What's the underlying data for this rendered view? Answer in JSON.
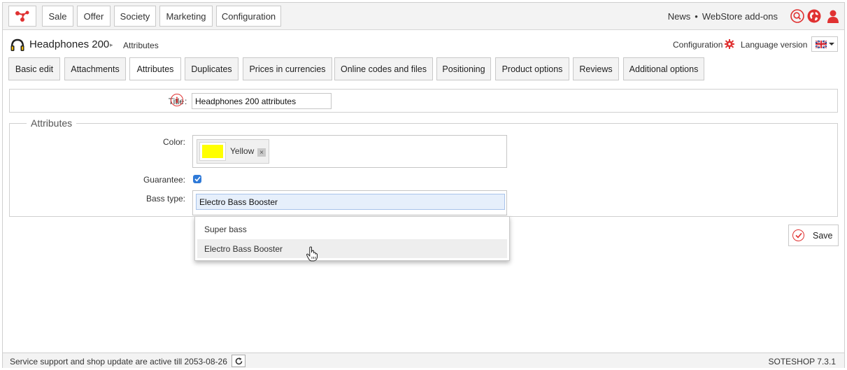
{
  "colors": {
    "accent": "#e03131",
    "checkbox": "#2f7ad8",
    "swatch_yellow": "#ffff00",
    "input_focus_bg": "#e6effb"
  },
  "topnav": {
    "logo_icon": "network-logo-icon",
    "items": [
      {
        "label": "Sale"
      },
      {
        "label": "Offer"
      },
      {
        "label": "Society"
      },
      {
        "label": "Marketing"
      },
      {
        "label": "Configuration"
      }
    ],
    "news": "News",
    "separator": "•",
    "addons": "WebStore add-ons",
    "icons": [
      "search-icon",
      "globe-icon",
      "user-icon"
    ]
  },
  "header": {
    "product_icon": "headphones-icon",
    "product_name": "Headphones 200",
    "breadcrumb_arrow": "▸",
    "breadcrumb_current": "Attributes",
    "config_label": "Configuration",
    "config_icon": "gear-icon",
    "language_label": "Language version",
    "language_flag": "uk-flag-icon"
  },
  "tabs": [
    {
      "label": "Basic edit"
    },
    {
      "label": "Attachments"
    },
    {
      "label": "Attributes"
    },
    {
      "label": "Duplicates"
    },
    {
      "label": "Prices in currencies"
    },
    {
      "label": "Online codes and files"
    },
    {
      "label": "Positioning"
    },
    {
      "label": "Product options"
    },
    {
      "label": "Reviews"
    },
    {
      "label": "Additional options"
    }
  ],
  "title_field": {
    "label": "Title",
    "info_icon": "i",
    "colon": ":",
    "value": "Headphones 200 attributes"
  },
  "attributes": {
    "legend": "Attributes",
    "color_label": "Color:",
    "color_tag": "Yellow",
    "color_remove": "×",
    "guarantee_label": "Guarantee:",
    "guarantee_checked": true,
    "bass_label": "Bass type:",
    "bass_value": "Electro Bass Booster"
  },
  "dropdown": {
    "options": [
      {
        "label": "Super bass"
      },
      {
        "label": "Electro Bass Booster"
      }
    ]
  },
  "save_button": {
    "label": "Save"
  },
  "footer": {
    "support_text": "Service support and shop update are active till 2053-08-26",
    "version": "SOTESHOP 7.3.1"
  }
}
